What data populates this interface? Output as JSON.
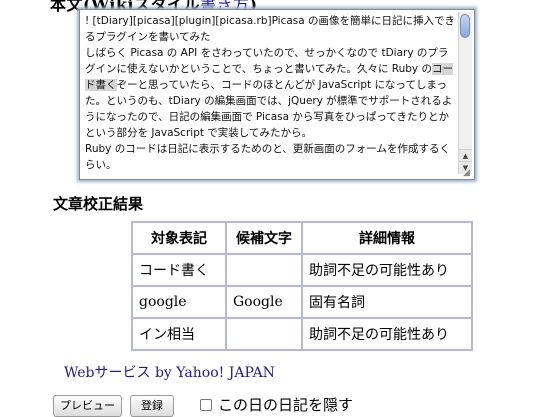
{
  "body_heading": {
    "prefix": "本文(Wikiスタイル",
    "link": "書き方",
    "suffix": ")"
  },
  "editor": {
    "content": "! [tDiary][picasa][plugin][picasa.rb]Picasa の画像を簡単に日記に挿入できるプラグインを書いてみた\nしばらく Picasa の API をさわっていたので、せっかくなので tDiary のプラグインに使えないかということで、ちょっと書いてみた。久々に Ruby の",
    "content_highlight": "コード書く",
    "content_rest": "ぞーと思っていたら、コードのほとんどが JavaScript になってしまった。というのも、tDiary の編集画面では、jQuery が標準でサポートされるようになったので、日記の編集画面で Picasa から写真をひっぱってきたりとかという部分を JavaScript で実装してみたから。\nRuby のコードは日記に表示するためのと、更新画面のフォームを作成するくらい。\n\n最初は jQuery のお作法がよくわからずに、あれやこれやと書いているう",
    "scroll_up": "▲",
    "scroll_down": "▼",
    "grip": "◢"
  },
  "proofread": {
    "title": "文章校正結果",
    "headers": [
      "対象表記",
      "候補文字",
      "詳細情報"
    ],
    "rows": [
      [
        "コード書く",
        "",
        "助詞不足の可能性あり"
      ],
      [
        "google",
        "Google",
        "固有名詞"
      ],
      [
        "イン相当",
        "",
        "助詞不足の可能性あり"
      ]
    ]
  },
  "credit_link": "Webサービス by Yahoo! JAPAN",
  "buttons": {
    "preview": "プレビュー",
    "register": "登録"
  },
  "hide_diary_label": "この日の日記を隠す"
}
